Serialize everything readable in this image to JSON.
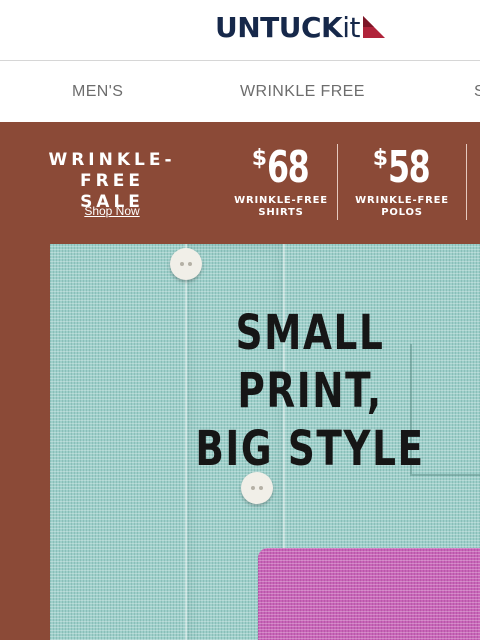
{
  "brand": {
    "name": "UNTUCK",
    "suffix": "it"
  },
  "nav": {
    "items": [
      "MEN'S",
      "WRINKLE FREE",
      "S"
    ]
  },
  "promo": {
    "title": "WRINKLE-FREE\nSALE",
    "cta": "Shop Now",
    "offers": [
      {
        "currency": "$",
        "price": "68",
        "caption": "WRINKLE-FREE\nSHIRTS"
      },
      {
        "currency": "$",
        "price": "58",
        "caption": "WRINKLE-FREE\nPOLOS"
      }
    ]
  },
  "hero": {
    "headline": "SMALL PRINT,\nBIG STYLE"
  },
  "colors": {
    "banner": "#8b4a37",
    "brand_navy": "#16284a",
    "brand_red": "#b0233a",
    "shirt_mint": "#9ecfca",
    "shirt_pink": "#c865b8"
  }
}
